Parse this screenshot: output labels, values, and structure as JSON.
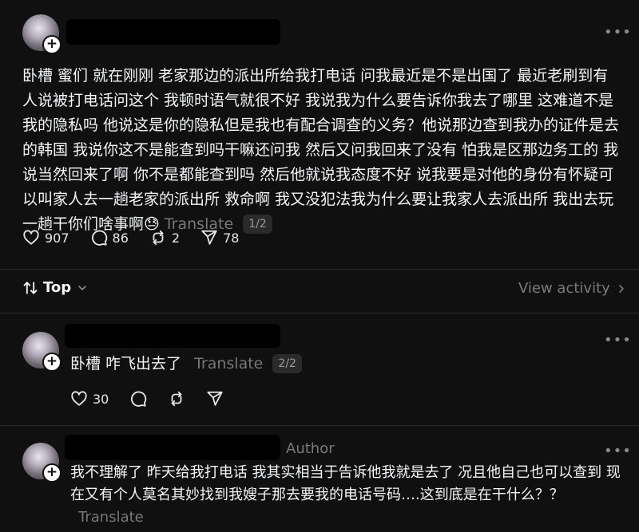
{
  "post": {
    "text": "卧槽 蜜们 就在刚刚 老家那边的派出所给我打电话 问我最近是不是出国了 最近老刷到有人说被打电话问这个 我顿时语气就很不好 我说我为什么要告诉你我去了哪里 这难道不是我的隐私吗 他说这是你的隐私但是我也有配合调查的义务？他说那边查到我办的证件是去的韩国 我说你这不是能查到吗干嘛还问我 然后又问我回来了没有 怕我是区那边务工的 我说当然回来了啊 你不是都能查到吗 然后他就说我态度不好 说我要是对他的身份有怀疑可以叫家人去一趟老家的派出所 救命啊 我又没犯法我为什么要让我家人去派出所 我出去玩一趟干你们啥事啊😓",
    "translate_label": "Translate",
    "pager": "1/2",
    "likes": "907",
    "replies": "86",
    "reposts": "2",
    "shares": "78"
  },
  "sort": {
    "label": "Top",
    "view_activity": "View activity"
  },
  "reply1": {
    "text": "卧槽 咋飞出去了",
    "translate_label": "Translate",
    "pager": "2/2",
    "likes": "30"
  },
  "reply2": {
    "author_badge": "Author",
    "text": "我不理解了 昨天给我打电话 我其实相当于告诉他我就是去了 况且他自己也可以查到 现在又有个人莫名其妙找到我嫂子那去要我的电话号码….这到底是在干什么？？",
    "translate_label": "Translate"
  },
  "icons": {
    "more": "more-horizontal-icon",
    "like": "heart-icon",
    "reply": "comment-bubble-icon",
    "repost": "repost-icon",
    "share": "send-icon",
    "sort": "sort-arrows-icon",
    "chevron": "chevron-down-icon"
  },
  "colors": {
    "background": "#101010",
    "text": "#f3f5f7",
    "muted": "#777777"
  }
}
